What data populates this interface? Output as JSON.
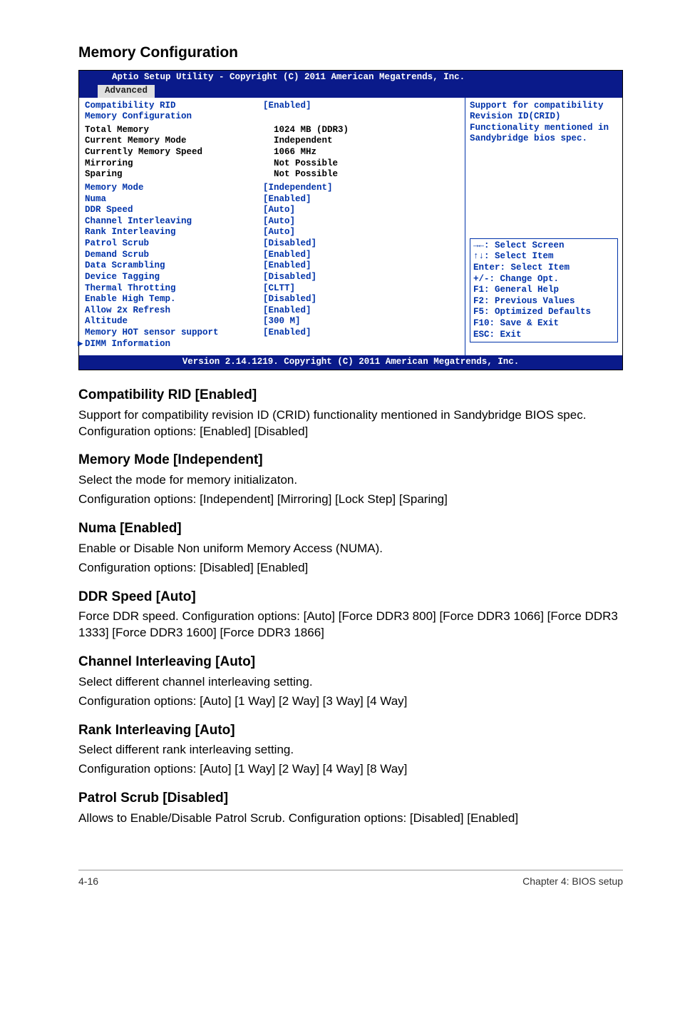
{
  "page_title": "Memory Configuration",
  "bios": {
    "header_title": "Aptio Setup Utility - Copyright (C) 2011 American Megatrends, Inc.",
    "tab": "Advanced",
    "rows": [
      {
        "label": "Compatibility RID",
        "value": "[Enabled]",
        "label_color": "blue",
        "value_color": "blue"
      },
      {
        "label": "Memory Configuration",
        "value": "",
        "label_color": "blue",
        "value_color": "blue"
      },
      {
        "spacer": true,
        "small": true
      },
      {
        "label": "Total Memory",
        "value": "  1024 MB (DDR3)",
        "label_color": "black",
        "value_color": "black"
      },
      {
        "label": "Current Memory Mode",
        "value": "  Independent",
        "label_color": "black",
        "value_color": "black"
      },
      {
        "label": "Currently Memory Speed",
        "value": "  1066 MHz",
        "label_color": "black",
        "value_color": "black"
      },
      {
        "label": "Mirroring",
        "value": "  Not Possible",
        "label_color": "black",
        "value_color": "black"
      },
      {
        "label": "Sparing",
        "value": "  Not Possible",
        "label_color": "black",
        "value_color": "black"
      },
      {
        "spacer": true,
        "small": true
      },
      {
        "label": "Memory Mode",
        "value": "[Independent]",
        "label_color": "blue",
        "value_color": "blue"
      },
      {
        "label": "Numa",
        "value": "[Enabled]",
        "label_color": "blue",
        "value_color": "blue"
      },
      {
        "label": "DDR Speed",
        "value": "[Auto]",
        "label_color": "blue",
        "value_color": "blue"
      },
      {
        "label": "Channel Interleaving",
        "value": "[Auto]",
        "label_color": "blue",
        "value_color": "blue"
      },
      {
        "label": "Rank Interleaving",
        "value": "[Auto]",
        "label_color": "blue",
        "value_color": "blue"
      },
      {
        "label": "Patrol Scrub",
        "value": "[Disabled]",
        "label_color": "blue",
        "value_color": "blue"
      },
      {
        "label": "Demand Scrub",
        "value": "[Enabled]",
        "label_color": "blue",
        "value_color": "blue"
      },
      {
        "label": "Data Scrambling",
        "value": "[Enabled]",
        "label_color": "blue",
        "value_color": "blue"
      },
      {
        "label": "Device Tagging",
        "value": "[Disabled]",
        "label_color": "blue",
        "value_color": "blue"
      },
      {
        "label": "Thermal Throtting",
        "value": "[CLTT]",
        "label_color": "blue",
        "value_color": "blue"
      },
      {
        "label": "Enable High Temp.",
        "value": "[Disabled]",
        "label_color": "blue",
        "value_color": "blue"
      },
      {
        "label": "Allow 2x Refresh",
        "value": "[Enabled]",
        "label_color": "blue",
        "value_color": "blue"
      },
      {
        "label": "Altitude",
        "value": "[300 M]",
        "label_color": "blue",
        "value_color": "blue"
      },
      {
        "label": "Memory HOT sensor support",
        "value": "[Enabled]",
        "label_color": "blue",
        "value_color": "blue"
      },
      {
        "label": "DIMM Information",
        "value": "",
        "label_color": "blue",
        "value_color": "blue",
        "arrow": true
      }
    ],
    "help_top": [
      "Support for compatibility",
      "Revision ID(CRID)",
      "Functionality mentioned in",
      "Sandybridge bios spec."
    ],
    "help_keys": [
      "→←: Select Screen",
      "↑↓:  Select Item",
      "Enter: Select Item",
      "+/-: Change Opt.",
      "F1: General Help",
      "F2: Previous Values",
      "F5: Optimized Defaults",
      "F10: Save & Exit",
      "ESC: Exit"
    ],
    "footer": "Version 2.14.1219. Copyright (C) 2011 American Megatrends, Inc."
  },
  "sections": [
    {
      "title": "Compatibility RID [Enabled]",
      "paras": [
        "Support for compatibility revision ID (CRID) functionality mentioned in Sandybridge BIOS spec. Configuration options: [Enabled] [Disabled]"
      ]
    },
    {
      "title": "Memory Mode [Independent]",
      "paras": [
        "Select the mode for memory initializaton.",
        "Configuration options: [Independent] [Mirroring] [Lock Step] [Sparing]"
      ]
    },
    {
      "title": "Numa [Enabled]",
      "paras": [
        "Enable or Disable Non uniform Memory Access (NUMA).",
        "Configuration options: [Disabled] [Enabled]"
      ]
    },
    {
      "title": "DDR Speed [Auto]",
      "paras": [
        "Force DDR speed. Configuration options: [Auto] [Force DDR3 800] [Force DDR3 1066] [Force DDR3 1333] [Force DDR3 1600] [Force DDR3 1866]"
      ]
    },
    {
      "title": "Channel Interleaving [Auto]",
      "paras": [
        "Select different channel interleaving setting.",
        "Configuration options: [Auto] [1 Way] [2 Way] [3 Way] [4 Way]"
      ]
    },
    {
      "title": "Rank Interleaving [Auto]",
      "paras": [
        "Select different rank interleaving setting.",
        "Configuration options: [Auto] [1 Way] [2 Way] [4 Way] [8 Way]"
      ]
    },
    {
      "title": "Patrol Scrub [Disabled]",
      "paras": [
        "Allows to Enable/Disable Patrol Scrub. Configuration options: [Disabled] [Enabled]"
      ]
    }
  ],
  "footer": {
    "left": "4-16",
    "right": "Chapter 4: BIOS setup"
  }
}
